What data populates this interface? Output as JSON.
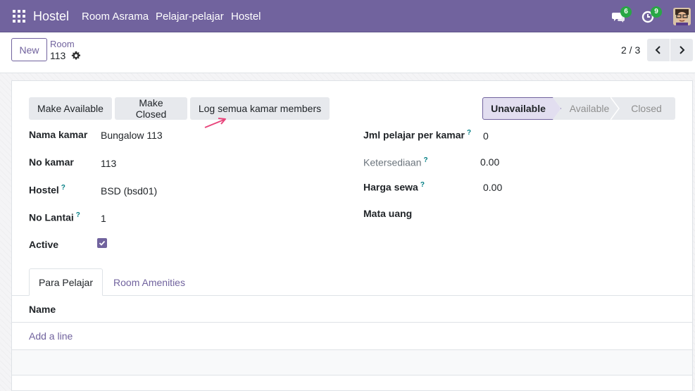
{
  "navbar": {
    "brand": "Hostel",
    "menu": [
      "Room Asrama",
      "Pelajar-pelajar",
      "Hostel"
    ],
    "messages_count": "6",
    "activities_count": "9",
    "bg_color": "#71639e"
  },
  "control_panel": {
    "new_label": "New",
    "breadcrumb": "Room",
    "record_name": "113",
    "pager": "2 / 3"
  },
  "actions": {
    "make_available": "Make Available",
    "make_closed": "Make Closed",
    "log_members": "Log semua kamar members"
  },
  "statusbar": {
    "steps": [
      "Unavailable",
      "Available",
      "Closed"
    ],
    "current": "Unavailable"
  },
  "fields_left": {
    "nama_kamar": {
      "label": "Nama kamar",
      "value": "Bungalow 113"
    },
    "no_kamar": {
      "label": "No kamar",
      "value": "113"
    },
    "hostel": {
      "label": "Hostel",
      "value": "BSD (bsd01)"
    },
    "no_lantai": {
      "label": "No Lantai",
      "value": "1"
    },
    "active": {
      "label": "Active",
      "checked": true
    }
  },
  "fields_right": {
    "jml_pelajar": {
      "label": "Jml pelajar per kamar",
      "value": "0"
    },
    "ketersediaan": {
      "label": "Ketersediaan",
      "value": "0.00"
    },
    "harga_sewa": {
      "label": "Harga sewa",
      "value": "0.00"
    },
    "mata_uang": {
      "label": "Mata uang",
      "value": ""
    }
  },
  "help_marker": "?",
  "notebook": {
    "tabs": [
      "Para Pelajar",
      "Room Amenities"
    ],
    "active_tab": "Para Pelajar",
    "column_header": "Name",
    "add_line": "Add a line"
  }
}
